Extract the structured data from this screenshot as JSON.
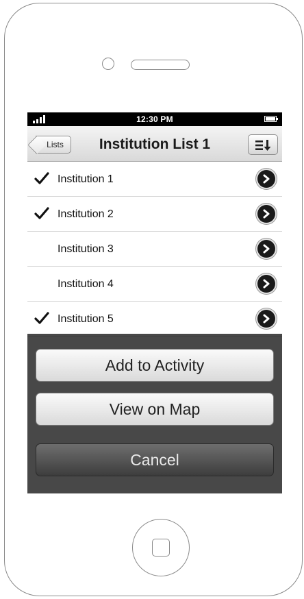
{
  "status_bar": {
    "time": "12:30 PM"
  },
  "nav": {
    "back_label": "Lists",
    "title": "Institution List 1"
  },
  "list": [
    {
      "label": "Institution 1",
      "checked": true
    },
    {
      "label": "Institution 2",
      "checked": true
    },
    {
      "label": "Institution 3",
      "checked": false
    },
    {
      "label": "Institution 4",
      "checked": false
    },
    {
      "label": "Institution 5",
      "checked": true
    }
  ],
  "action_sheet": {
    "add_label": "Add to Activity",
    "map_label": "View on Map",
    "cancel_label": "Cancel"
  },
  "icons": {
    "signal": "signal-bars-icon",
    "battery": "battery-icon",
    "sort": "sort-list-icon",
    "check": "checkmark-icon",
    "disclosure": "chevron-right-circle-icon"
  }
}
